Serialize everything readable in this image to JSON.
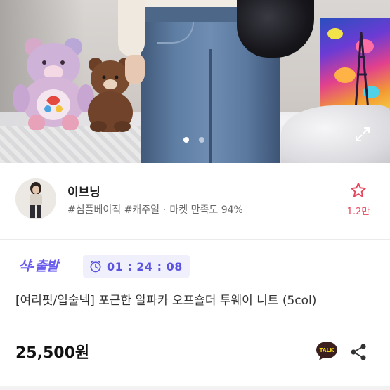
{
  "gallery": {
    "slides": 2,
    "active_slide": 1
  },
  "shop": {
    "name": "이브닝",
    "tags": "#심플베이직 #캐주얼",
    "satisfaction": "마켓 만족도 94%",
    "favorite_count": "1.2만"
  },
  "deal": {
    "badge": "샥-출발",
    "timer": "01 : 24 : 08"
  },
  "product": {
    "title": "[여리핏/입술넥] 포근한 알파카 오프숄더 투웨이 니트 (5col)",
    "price": "25,500원"
  },
  "actions": {
    "talk_label": "TALK"
  },
  "colors": {
    "accent_purple": "#6a5cf0",
    "favorite_red": "#e6475d",
    "timer_bg": "#f0f0fd"
  },
  "icons": [
    "expand-icon",
    "star-icon",
    "clock-icon",
    "kakao-talk-icon",
    "share-icon"
  ]
}
